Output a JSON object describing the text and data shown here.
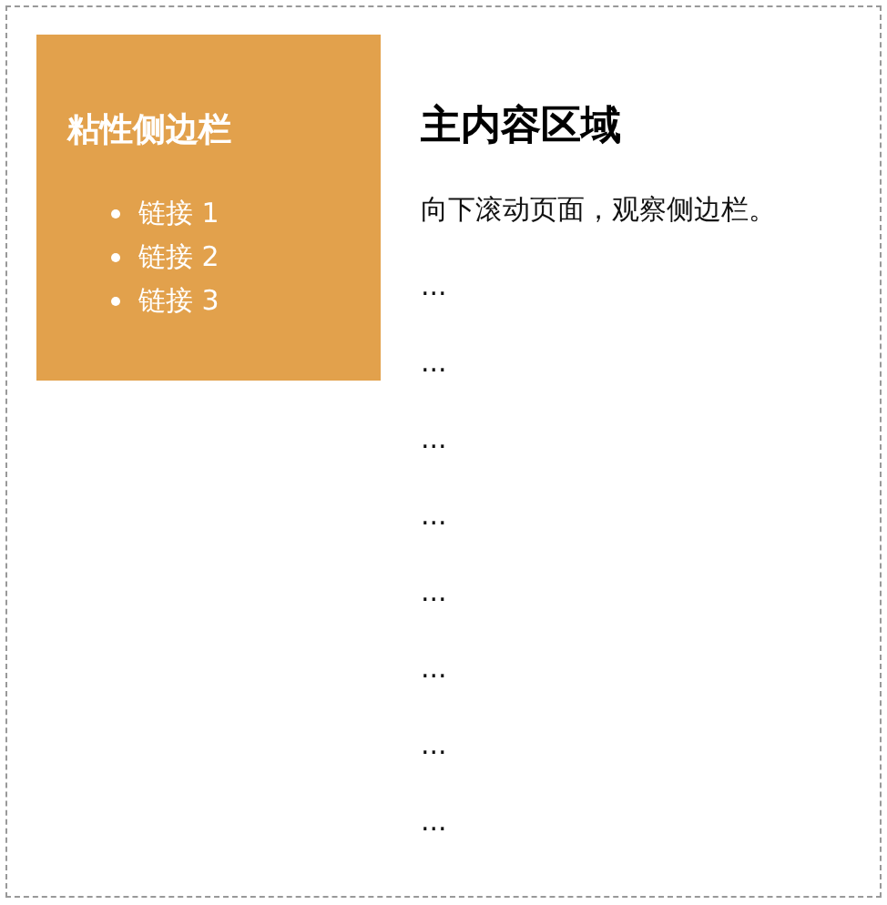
{
  "sidebar": {
    "title": "粘性侧边栏",
    "links": [
      {
        "label": "链接 1"
      },
      {
        "label": "链接 2"
      },
      {
        "label": "链接 3"
      }
    ]
  },
  "main": {
    "title": "主内容区域",
    "intro": "向下滚动页面，观察侧边栏。",
    "paragraphs": [
      "...",
      "...",
      "...",
      "...",
      "...",
      "...",
      "...",
      "..."
    ]
  }
}
